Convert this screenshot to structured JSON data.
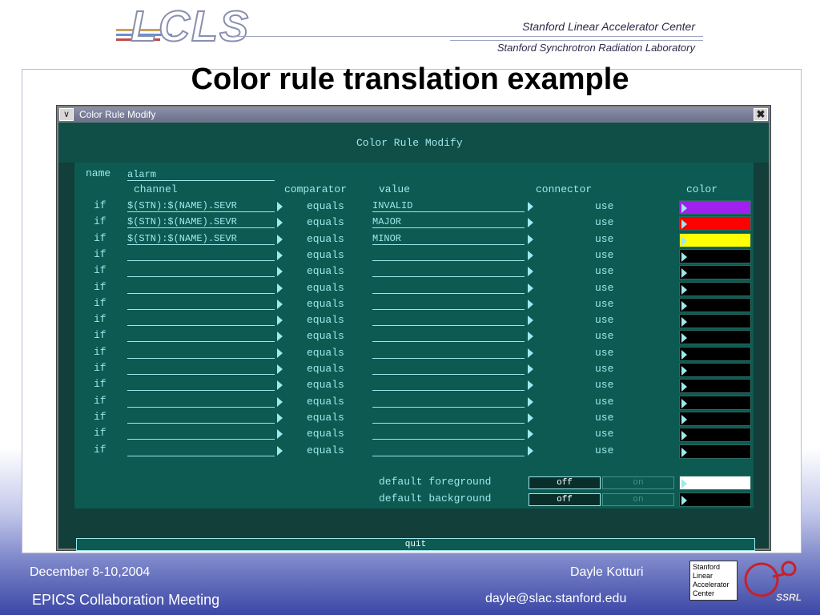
{
  "header": {
    "logo_text": "LCLS",
    "org1": "Stanford Linear Accelerator Center",
    "org2": "Stanford Synchrotron Radiation Laboratory",
    "slide_title": "Color rule translation example"
  },
  "window": {
    "title": "Color Rule Modify",
    "heading": "Color Rule Modify",
    "name_label": "name",
    "name_value": "alarm",
    "columns": {
      "channel": "channel",
      "comparator": "comparator",
      "value": "value",
      "connector": "connector",
      "color": "color"
    },
    "rows": [
      {
        "if": "if",
        "channel": "$(STN):$(NAME).SEVR",
        "comparator": "equals",
        "value": "INVALID",
        "connector": "use",
        "color": "#a020f0"
      },
      {
        "if": "if",
        "channel": "$(STN):$(NAME).SEVR",
        "comparator": "equals",
        "value": "MAJOR",
        "connector": "use",
        "color": "#ff0000"
      },
      {
        "if": "if",
        "channel": "$(STN):$(NAME).SEVR",
        "comparator": "equals",
        "value": "MINOR",
        "connector": "use",
        "color": "#ffff00"
      },
      {
        "if": "if",
        "channel": "",
        "comparator": "equals",
        "value": "",
        "connector": "use",
        "color": "#000000"
      },
      {
        "if": "if",
        "channel": "",
        "comparator": "equals",
        "value": "",
        "connector": "use",
        "color": "#000000"
      },
      {
        "if": "if",
        "channel": "",
        "comparator": "equals",
        "value": "",
        "connector": "use",
        "color": "#000000"
      },
      {
        "if": "if",
        "channel": "",
        "comparator": "equals",
        "value": "",
        "connector": "use",
        "color": "#000000"
      },
      {
        "if": "if",
        "channel": "",
        "comparator": "equals",
        "value": "",
        "connector": "use",
        "color": "#000000"
      },
      {
        "if": "if",
        "channel": "",
        "comparator": "equals",
        "value": "",
        "connector": "use",
        "color": "#000000"
      },
      {
        "if": "if",
        "channel": "",
        "comparator": "equals",
        "value": "",
        "connector": "use",
        "color": "#000000"
      },
      {
        "if": "if",
        "channel": "",
        "comparator": "equals",
        "value": "",
        "connector": "use",
        "color": "#000000"
      },
      {
        "if": "if",
        "channel": "",
        "comparator": "equals",
        "value": "",
        "connector": "use",
        "color": "#000000"
      },
      {
        "if": "if",
        "channel": "",
        "comparator": "equals",
        "value": "",
        "connector": "use",
        "color": "#000000"
      },
      {
        "if": "if",
        "channel": "",
        "comparator": "equals",
        "value": "",
        "connector": "use",
        "color": "#000000"
      },
      {
        "if": "if",
        "channel": "",
        "comparator": "equals",
        "value": "",
        "connector": "use",
        "color": "#000000"
      },
      {
        "if": "if",
        "channel": "",
        "comparator": "equals",
        "value": "",
        "connector": "use",
        "color": "#000000"
      }
    ],
    "default_foreground": {
      "label": "default foreground",
      "off": "off",
      "on": "on",
      "color": "#ffffff"
    },
    "default_background": {
      "label": "default background",
      "off": "off",
      "on": "on",
      "color": "#000000"
    },
    "quit": "quit"
  },
  "footer": {
    "date": "December 8-10,2004",
    "meeting": "EPICS Collaboration Meeting",
    "author": "Dayle Kotturi",
    "email": "dayle@slac.stanford.edu",
    "slac_logo": [
      "Stanford",
      "Linear",
      "Accelerator",
      "Center"
    ],
    "ssrl_logo": "SSRL"
  }
}
